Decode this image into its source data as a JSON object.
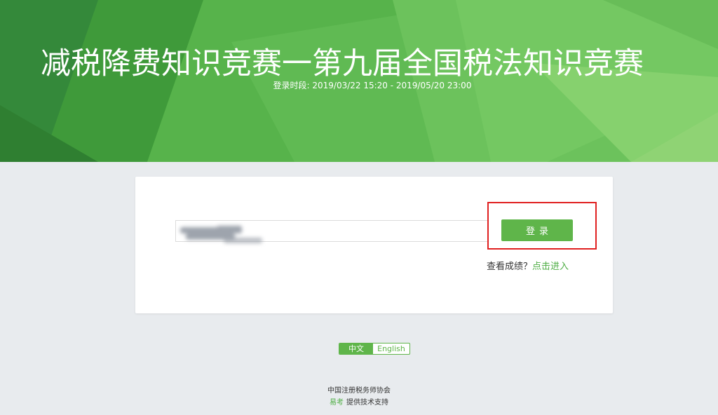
{
  "banner": {
    "title": "减税降费知识竞赛一第九届全国税法知识竞赛",
    "time_label": "登录时段: 2019/03/22 15:20 - 2019/05/20 23:00"
  },
  "login": {
    "input_value": "",
    "button_label": "登录",
    "score_prompt": "查看成绩？",
    "score_link": "点击进入"
  },
  "language": {
    "options": [
      "中文",
      "English"
    ],
    "selected": "中文"
  },
  "footer": {
    "organization": "中国注册税务师协会",
    "support_brand": "易考",
    "support_text": "提供技术支持"
  },
  "colors": {
    "brand_green": "#5fb54a",
    "highlight_red": "#e02020",
    "background": "#e8ebee"
  }
}
